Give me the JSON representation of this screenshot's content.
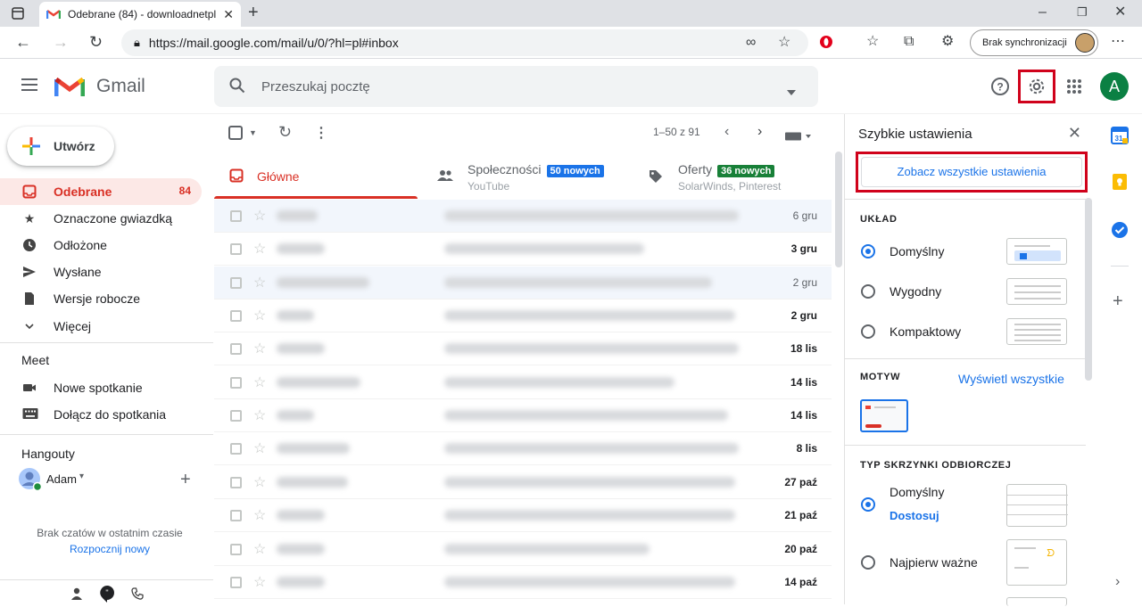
{
  "browser": {
    "tab_title": "Odebrane (84) - downloadnetpl",
    "url": "https://mail.google.com/mail/u/0/?hl=pl#inbox",
    "sync_label": "Brak synchronizacji"
  },
  "gmail": {
    "logo_text": "Gmail",
    "search_placeholder": "Przeszukaj pocztę",
    "avatar_letter": "A",
    "accent": "#d93025"
  },
  "nav": {
    "compose": "Utwórz",
    "items": [
      {
        "label": "Odebrane",
        "count": "84",
        "icon": "inbox-icon"
      },
      {
        "label": "Oznaczone gwiazdką",
        "count": "",
        "icon": "star-icon"
      },
      {
        "label": "Odłożone",
        "count": "",
        "icon": "clock-icon"
      },
      {
        "label": "Wysłane",
        "count": "",
        "icon": "send-icon"
      },
      {
        "label": "Wersje robocze",
        "count": "",
        "icon": "draft-icon"
      },
      {
        "label": "Więcej",
        "count": "",
        "icon": "chevron-down-icon"
      }
    ],
    "meet": {
      "header": "Meet",
      "new_meeting": "Nowe spotkanie",
      "join_meeting": "Dołącz do spotkania"
    },
    "hangouts": {
      "header": "Hangouty",
      "user": "Adam",
      "no_chats": "Brak czatów w ostatnim czasie",
      "start_new": "Rozpocznij nowy"
    }
  },
  "toolbar": {
    "pagination": "1–50 z 91"
  },
  "tabs": [
    {
      "label": "Główne",
      "sub": "",
      "badge": ""
    },
    {
      "label": "Społeczności",
      "sub": "YouTube",
      "badge": "50 nowych",
      "badge_color": "#1a73e8"
    },
    {
      "label": "Oferty",
      "sub": "SolarWinds, Pinterest",
      "badge": "36 nowych",
      "badge_color": "#188038"
    }
  ],
  "emails": [
    {
      "date": "6 gru",
      "unread": false
    },
    {
      "date": "3 gru",
      "unread": true
    },
    {
      "date": "2 gru",
      "unread": false
    },
    {
      "date": "2 gru",
      "unread": true
    },
    {
      "date": "18 lis",
      "unread": true
    },
    {
      "date": "14 lis",
      "unread": true
    },
    {
      "date": "14 lis",
      "unread": true
    },
    {
      "date": "8 lis",
      "unread": true
    },
    {
      "date": "27 paź",
      "unread": true
    },
    {
      "date": "21 paź",
      "unread": true
    },
    {
      "date": "20 paź",
      "unread": true
    },
    {
      "date": "14 paź",
      "unread": true
    }
  ],
  "quick_settings": {
    "title": "Szybkie ustawienia",
    "see_all": "Zobacz wszystkie ustawienia",
    "layout_header": "UKŁAD",
    "layout_options": [
      "Domyślny",
      "Wygodny",
      "Kompaktowy"
    ],
    "theme_header": "MOTYW",
    "theme_link": "Wyświetl wszystkie",
    "inbox_type_header": "TYP SKRZYNKI ODBIORCZEJ",
    "inbox_default": "Domyślny",
    "inbox_customize": "Dostosuj",
    "inbox_important": "Najpierw ważne"
  }
}
